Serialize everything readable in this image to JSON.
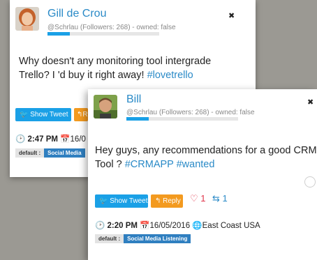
{
  "colors": {
    "accent": "#1aa0e6",
    "link": "#2a8ac7",
    "reply": "#f39a1f",
    "heart": "#e0344a",
    "tag": "#2f7fc0"
  },
  "cards": [
    {
      "name": "Gill de Crou",
      "meta": "@Schrlau (Followers: 268) - owned: false",
      "progress": 0.2,
      "close": "✖",
      "tweet_lines": [
        "Why doesn't any monitoring tool intergrade",
        "Trello? I 'd buy it right away! "
      ],
      "hashtags": [
        "#lovetrello"
      ],
      "show_tweet": "Show Tweet",
      "reply": "Re",
      "time": "2:47 PM",
      "date": "16/0",
      "tag_key": "default :",
      "tag_value": "Social Media"
    },
    {
      "name": "Bill",
      "meta": "@Schrlau (Followers: 268) - owned: false",
      "progress": 0.2,
      "close": "✖",
      "tweet_lines": [
        "Hey guys, any recommendations for a good CRM",
        "Tool ? "
      ],
      "hashtags": [
        "#CRMAPP",
        "#wanted"
      ],
      "show_tweet": "Show Tweet",
      "reply": "Reply",
      "likes": "1",
      "retweets": "1",
      "time": "2:20 PM",
      "date": "16/05/2016",
      "location": "East Coast USA",
      "tag_key": "default :",
      "tag_value": "Social Media Listening"
    }
  ]
}
